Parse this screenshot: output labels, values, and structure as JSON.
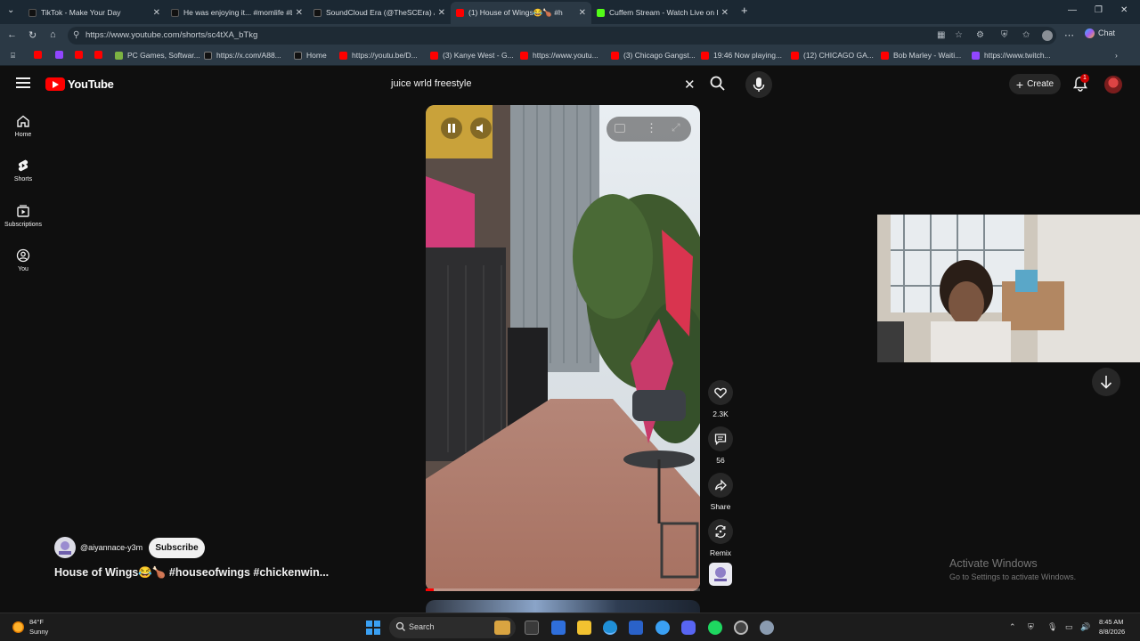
{
  "browser": {
    "tabs": [
      {
        "title": "TikTok - Make Your Day",
        "icon": "tiktok-icon",
        "color": "#111111",
        "active": false
      },
      {
        "title": "He was enjoying it... #momlife #b",
        "icon": "tiktok-icon",
        "color": "#111111",
        "active": false
      },
      {
        "title": "SoundCloud Era (@TheSCEra) / X",
        "icon": "x-icon",
        "color": "#111111",
        "active": false
      },
      {
        "title": "(1) House of Wings😂🍗 #h",
        "icon": "youtube-icon",
        "color": "#ff0000",
        "active": true
      },
      {
        "title": "Cuffem Stream - Watch Live on Ki",
        "icon": "kick-icon",
        "color": "#53fc18",
        "active": false
      }
    ],
    "url": "https://www.youtube.com/shorts/sc4tXA_bTkg",
    "chat_label": "Chat",
    "bookmarks": [
      {
        "label": "",
        "icon": "youtube-icon",
        "color": "#ff0000"
      },
      {
        "label": "",
        "icon": "twitch-icon",
        "color": "#9146ff"
      },
      {
        "label": "",
        "icon": "youtube-icon",
        "color": "#ff0000"
      },
      {
        "label": "",
        "icon": "youtube-icon",
        "color": "#ff0000"
      },
      {
        "label": "PC Games, Softwar...",
        "icon": "games-icon",
        "color": "#7cb342"
      },
      {
        "label": "https://x.com/A88...",
        "icon": "x-icon",
        "color": "#111111"
      },
      {
        "label": "Home",
        "icon": "x-icon",
        "color": "#111111"
      },
      {
        "label": "https://youtu.be/D...",
        "icon": "youtube-icon",
        "color": "#ff0000"
      },
      {
        "label": "(3) Kanye West - G...",
        "icon": "youtube-icon",
        "color": "#ff0000"
      },
      {
        "label": "https://www.youtu...",
        "icon": "youtube-icon",
        "color": "#ff0000"
      },
      {
        "label": "(3) Chicago Gangst...",
        "icon": "youtube-icon",
        "color": "#ff0000"
      },
      {
        "label": "19:46 Now playing...",
        "icon": "youtube-icon",
        "color": "#ff0000"
      },
      {
        "label": "(12) CHICAGO GA...",
        "icon": "youtube-icon",
        "color": "#ff0000"
      },
      {
        "label": "Bob Marley - Waiti...",
        "icon": "youtube-icon",
        "color": "#ff0000"
      },
      {
        "label": "https://www.twitch...",
        "icon": "twitch-icon",
        "color": "#9146ff"
      }
    ]
  },
  "youtube": {
    "logo_text": "YouTube",
    "search_query": "juice wrld freestyle",
    "create_label": "Create",
    "notification_count": "1",
    "nav": [
      {
        "label": "Home",
        "icon": "home-icon"
      },
      {
        "label": "Shorts",
        "icon": "shorts-icon"
      },
      {
        "label": "Subscriptions",
        "icon": "subscriptions-icon"
      },
      {
        "label": "You",
        "icon": "you-icon"
      }
    ],
    "short": {
      "channel": "@aiyannace-y3m",
      "subscribe_label": "Subscribe",
      "title": "House of Wings😂🍗 #houseofwings #chickenwin...",
      "likes": "2.3K",
      "comments": "56",
      "share_label": "Share",
      "remix_label": "Remix",
      "progress": 0.03
    }
  },
  "watermark": {
    "line1": "Activate Windows",
    "line2": "Go to Settings to activate Windows."
  },
  "taskbar": {
    "temperature": "84°F",
    "condition": "Sunny",
    "search_placeholder": "Search",
    "time": "8:45 AM",
    "date": "8/8/2026",
    "apps": [
      {
        "icon": "cat-app-icon",
        "color": "#d9a441"
      },
      {
        "icon": "terminal-icon",
        "color": "#3a3a3a"
      },
      {
        "icon": "photos-icon",
        "color": "#2f6fdb"
      },
      {
        "icon": "file-explorer-icon",
        "color": "#f2c230"
      },
      {
        "icon": "edge-icon",
        "color": "#1f8fd6"
      },
      {
        "icon": "store-icon",
        "color": "#2a62c9"
      },
      {
        "icon": "browser-icon",
        "color": "#3aa0f3"
      },
      {
        "icon": "discord-icon",
        "color": "#5865f2"
      },
      {
        "icon": "spotify-icon",
        "color": "#1ed760"
      },
      {
        "icon": "obs-icon",
        "color": "#444444"
      },
      {
        "icon": "settings-icon",
        "color": "#8a9bb0"
      }
    ]
  }
}
